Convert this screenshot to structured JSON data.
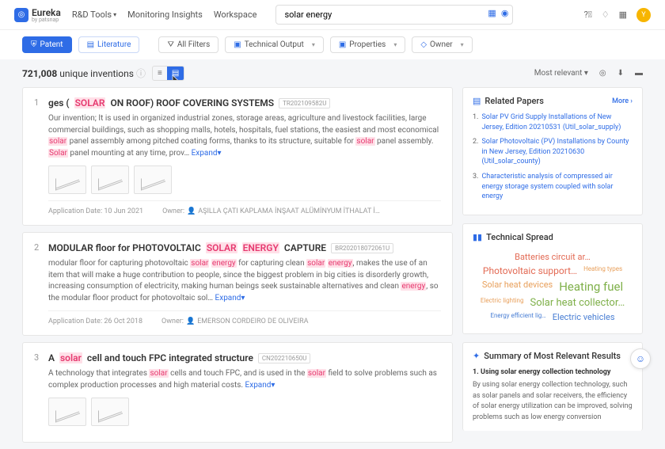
{
  "logo": {
    "brand": "Eureka",
    "sub": "by patsnap"
  },
  "nav": {
    "rd": "R&D Tools",
    "mon": "Monitoring Insights",
    "ws": "Workspace"
  },
  "search": {
    "value": "solar energy"
  },
  "avatar": "Y",
  "tabs": {
    "patent": "Patent",
    "lit": "Literature"
  },
  "filters": {
    "all": "All Filters",
    "tech": "Technical Output",
    "props": "Properties",
    "owner": "Owner"
  },
  "count": {
    "n": "721,008",
    "label": "unique inventions"
  },
  "sort": "Most relevant",
  "results": [
    {
      "n": "1",
      "title_pre": "ges (",
      "title_hl": "SOLAR",
      "title_mid": " ON ROOF) ROOF COVERING SYSTEMS",
      "tag": "TR202109582U",
      "snippet": "Our invention; It is used in organized industrial zones, storage areas, agriculture and livestock facilities, large commercial buildings, such as shopping malls, hotels, hospitals, fuel stations, the easiest and most economical ",
      "snip_hl1": "solar",
      "snip_mid1": " panel assembly among pitched coating forms, thanks to its structure, suitable for ",
      "snip_hl2": "solar",
      "snip_mid2": " panel assembly. ",
      "snip_hl3": "Solar",
      "snip_end": " panel mounting at any time, prov…",
      "app": "Application Date: 10 Jun 2021",
      "owner": "AŞILLA ÇATI KAPLAMA İNŞAAT ALÜMİNYUM İTHALAT İ…",
      "thumbs": 3
    },
    {
      "n": "2",
      "title_pre": "MODULAR floor for PHOTOVOLTAIC ",
      "title_hl": "SOLAR",
      "title_mid": " ",
      "title_hl2": "ENERGY",
      "title_end": " CAPTURE",
      "tag": "BR202018072061U",
      "snippet": "modular floor for capturing photovoltaic ",
      "snip_hl1": "solar",
      "snip_mid1": " ",
      "snip_hl1b": "energy",
      "snip_mid1c": " for capturing clean ",
      "snip_hl2": "solar",
      "snip_mid2": " ",
      "snip_hl2b": "energy",
      "snip_mid2c": ", makes the use of an item that will make a huge contribution to people, since the biggest problem in big cities is disorderly growth, increasing consumption of electricity, making human beings seek sustainable alternatives and clean ",
      "snip_hl3": "energy",
      "snip_end": ", so the modular floor product for photovoltaic sol…",
      "app": "Application Date: 26 Oct 2018",
      "owner": "EMERSON CORDEIRO DE OLIVEIRA",
      "thumbs": 0
    },
    {
      "n": "3",
      "title_pre": "A ",
      "title_hl": "solar",
      "title_mid": " cell and touch FPC integrated structure",
      "tag": "CN202210650U",
      "snippet": "A technology that integrates ",
      "snip_hl1": "solar",
      "snip_mid1": " cells and touch FPC, and is used in the ",
      "snip_hl2": "solar",
      "snip_end": " field to solve problems such as complex production processes and high material costs.",
      "app": "",
      "owner": "",
      "thumbs": 2
    }
  ],
  "expand": "Expand",
  "related": {
    "title": "Related Papers",
    "more": "More ›",
    "items": [
      "Solar PV Grid Supply Installations of New Jersey, Edition 20210531 (Util_solar_supply)",
      "Solar Photovoltaic (PV) Installations by County in New Jersey, Edition 20210630 (Util_solar_county)",
      "Characteristic analysis of compressed air energy storage system coupled with solar energy"
    ]
  },
  "spread": {
    "title": "Technical Spread",
    "terms": [
      {
        "t": "Batteries circuit ar…",
        "c": "#e36b55",
        "s": 11
      },
      {
        "t": "Photovoltaic support…",
        "c": "#e36b55",
        "s": 12
      },
      {
        "t": "Heating types",
        "c": "#e8a05c",
        "s": 8
      },
      {
        "t": "Solar heat devices",
        "c": "#e8a05c",
        "s": 11
      },
      {
        "t": "Heating fuel",
        "c": "#7fb04a",
        "s": 15
      },
      {
        "t": "Electric lighting",
        "c": "#e8a05c",
        "s": 8
      },
      {
        "t": "Solar heat collector…",
        "c": "#7fb04a",
        "s": 13
      },
      {
        "t": "Energy efficient lig…",
        "c": "#4a7fd4",
        "s": 8
      },
      {
        "t": "Electric vehicles",
        "c": "#4a7fd4",
        "s": 11
      }
    ]
  },
  "summary": {
    "title": "Summary of Most Relevant Results",
    "h": "1. Using solar energy collection technology",
    "body": "By using solar energy collection technology, such as solar panels and solar receivers, the efficiency of solar energy utilization can be improved, solving problems such as low energy conversion"
  }
}
